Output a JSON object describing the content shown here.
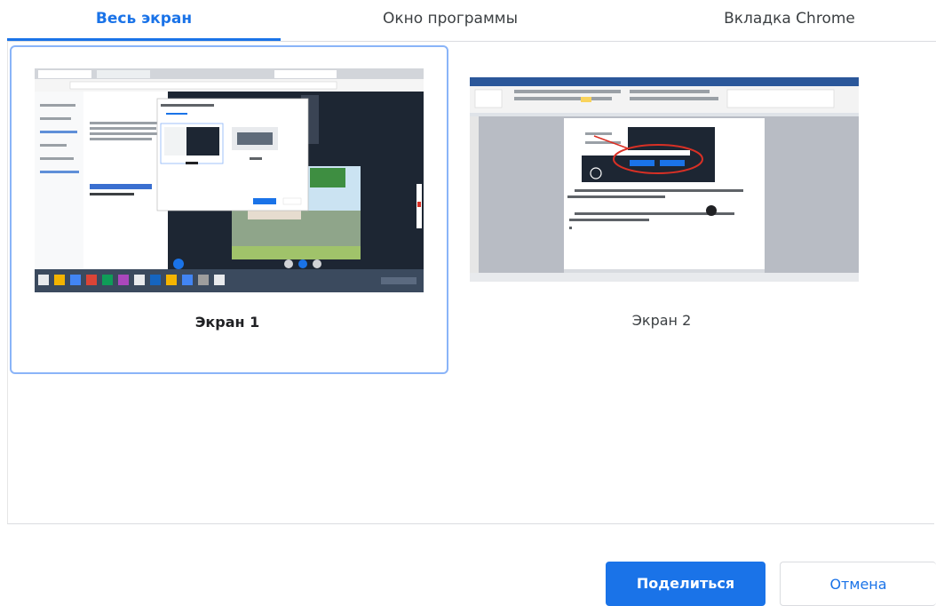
{
  "tabs": [
    {
      "label": "Весь экран",
      "active": true
    },
    {
      "label": "Окно программы",
      "active": false
    },
    {
      "label": "Вкладка Chrome",
      "active": false
    }
  ],
  "screens": [
    {
      "label": "Экран 1",
      "selected": true
    },
    {
      "label": "Экран 2",
      "selected": false
    }
  ],
  "buttons": {
    "share_label": "Поделиться",
    "cancel_label": "Отмена"
  },
  "colors": {
    "accent": "#1a73e8",
    "selected_border": "#8ab4f8",
    "divider": "#dadce0"
  }
}
